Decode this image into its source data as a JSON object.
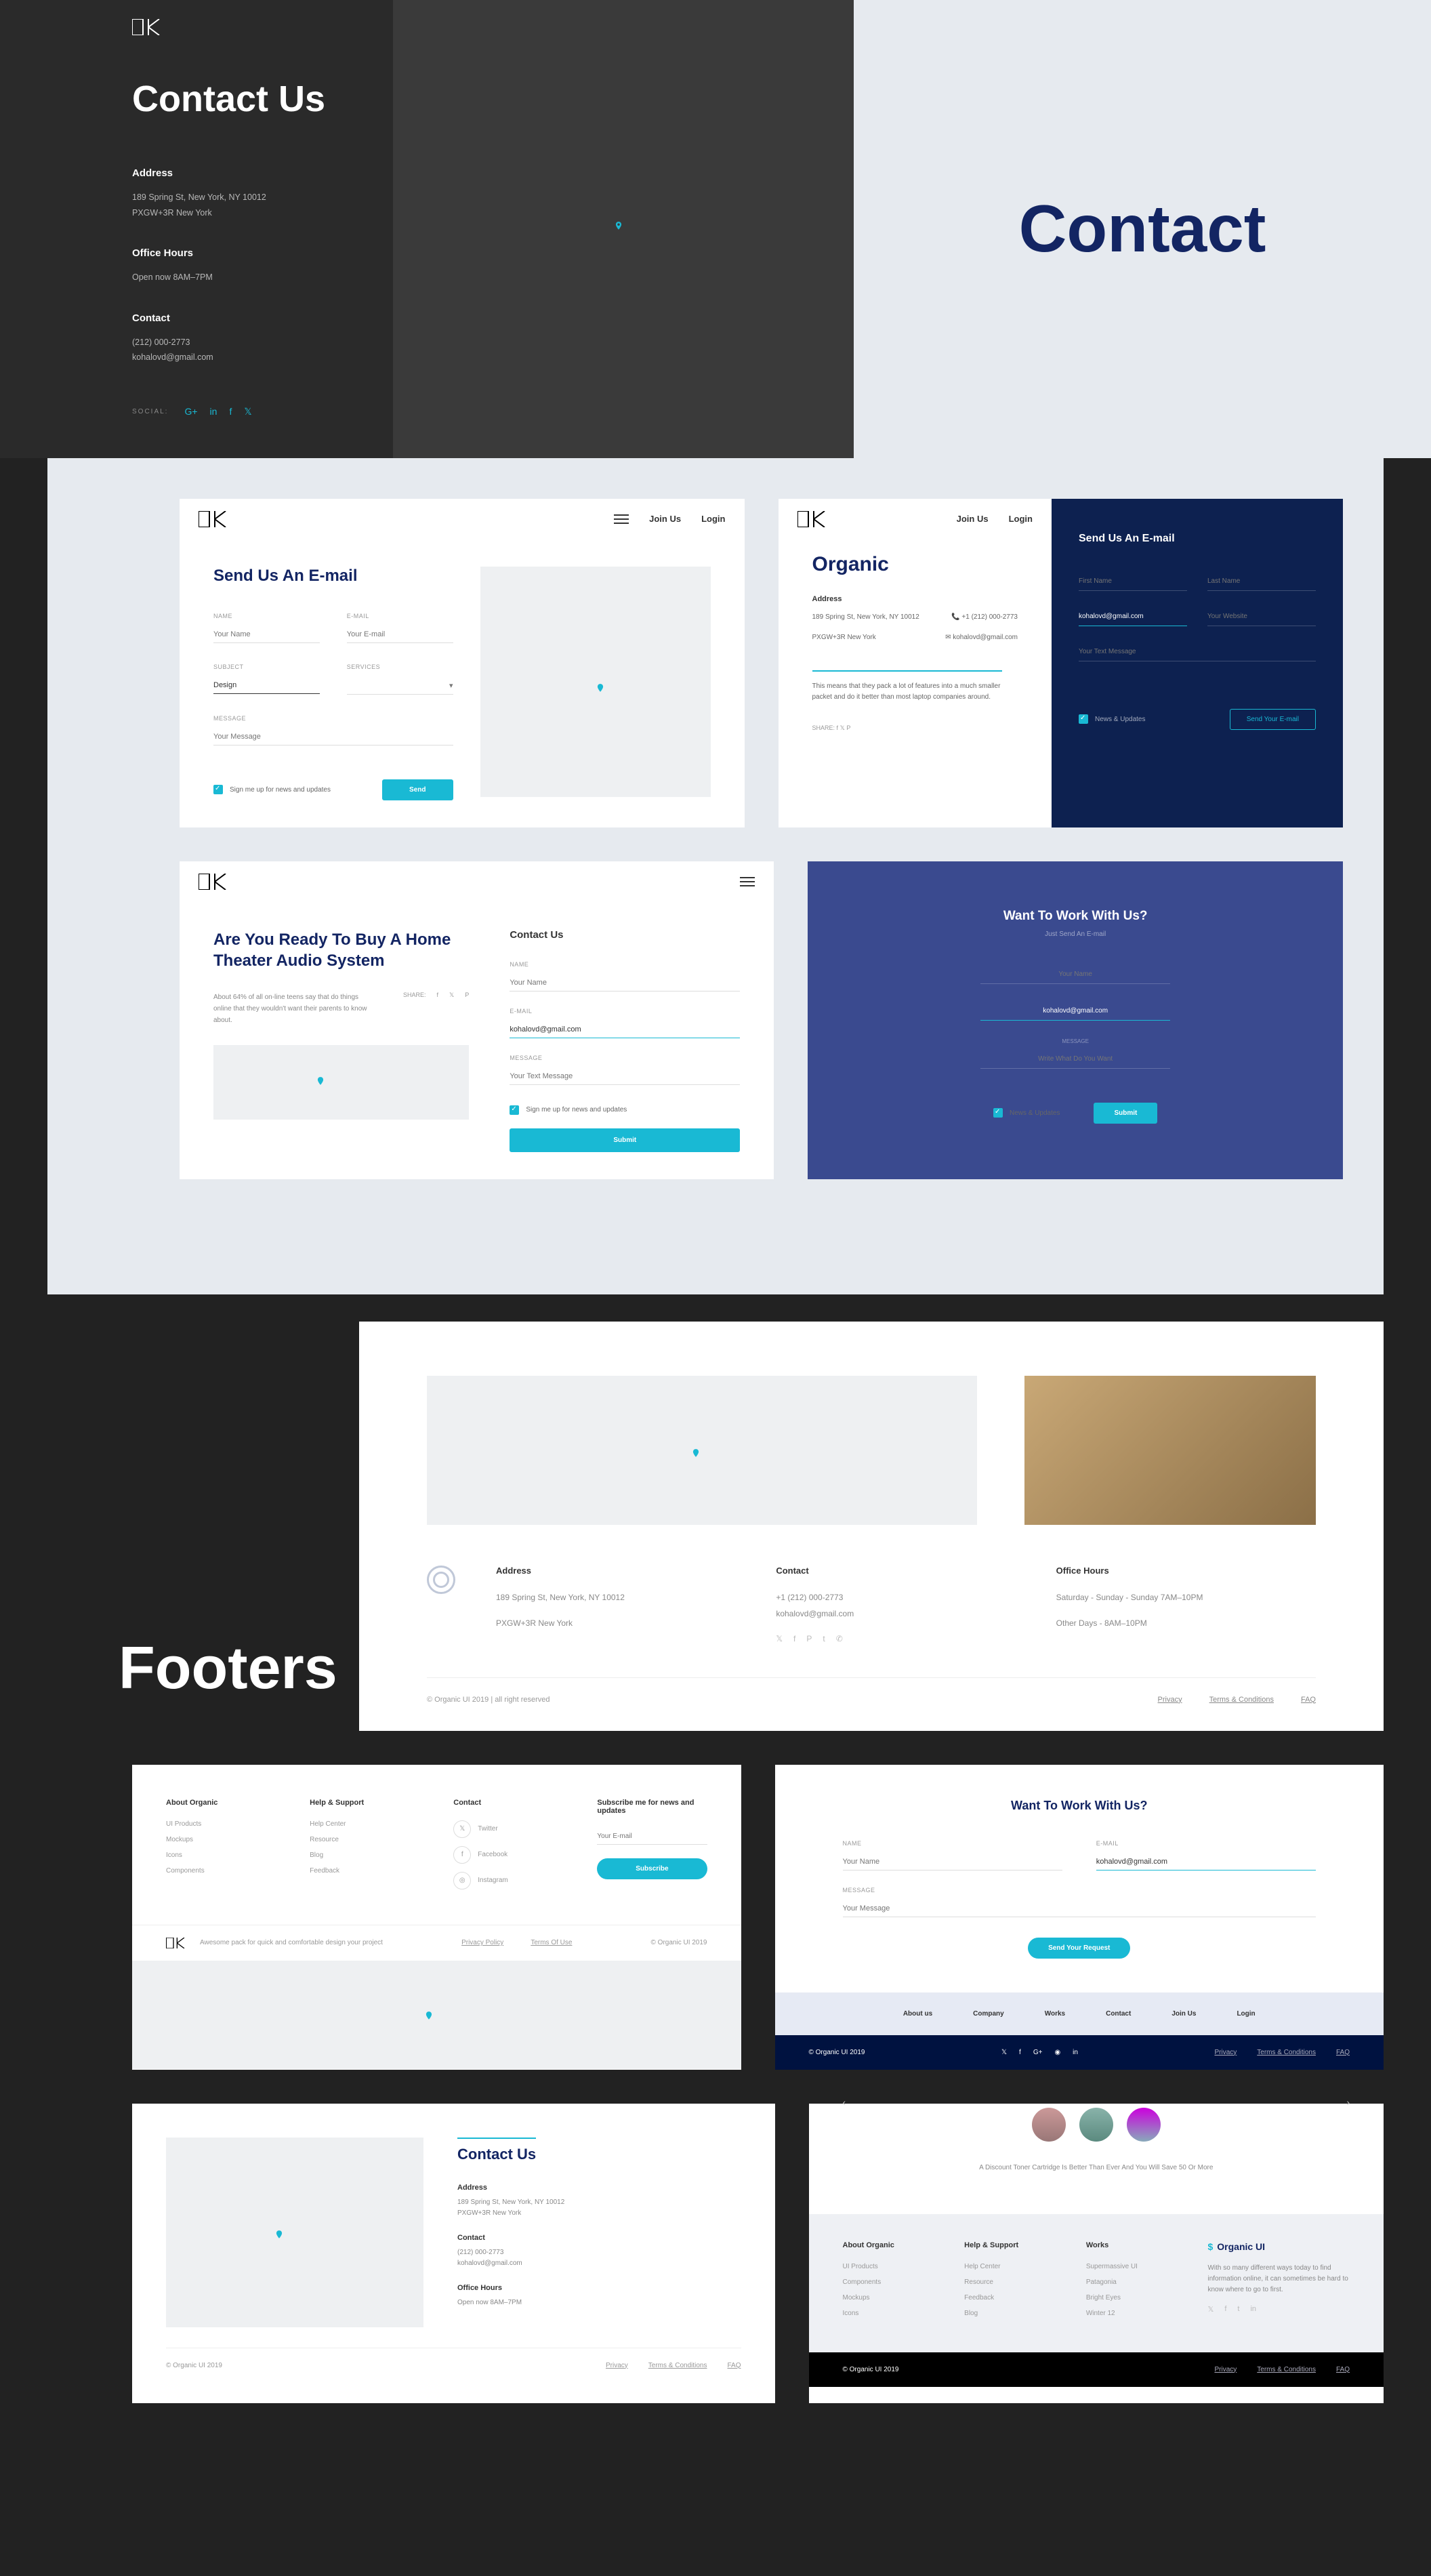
{
  "nav": {
    "join": "Join Us",
    "login": "Login"
  },
  "hero": {
    "title": "Contact Us",
    "address_label": "Address",
    "address_text": "189 Spring St, New York, NY 10012\nPXGW+3R New York",
    "hours_label": "Office Hours",
    "hours_text": "Open now 8AM–7PM",
    "contact_label": "Contact",
    "contact_text": "(212) 000-2773\nkohalovd@gmail.com",
    "social_label": "SOCIAL:",
    "big_title": "Contact"
  },
  "card_a": {
    "title": "Send Us An E-mail",
    "name_label": "NAME",
    "name_ph": "Your Name",
    "email_label": "E-MAIL",
    "email_ph": "Your E-mail",
    "subject_label": "SUBJECT",
    "subject_val": "Design",
    "services_label": "SERVICES",
    "message_label": "MESSAGE",
    "message_ph": "Your Message",
    "signup": "Sign me up for news and updates",
    "send": "Send"
  },
  "card_b": {
    "title": "Organic",
    "address_label": "Address",
    "addr1": "189 Spring St, New York, NY 10012",
    "addr2": "PXGW+3R New York",
    "phone_icon_text": "+1 (212) 000-2773",
    "email_icon_text": "kohalovd@gmail.com",
    "desc": "This means that they pack a lot of features into a much smaller packet and do it better than most laptop companies around.",
    "share": "SHARE:",
    "send_title": "Send Us An E-mail",
    "fn": "First Name",
    "ln": "Last Name",
    "email_val": "kohalovd@gmail.com",
    "web": "Your Website",
    "msg": "Your Text Message",
    "news": "News & Updates",
    "btn": "Send Your E-mail"
  },
  "card_c": {
    "title": "Are You Ready To Buy A Home Theater Audio System",
    "text": "About 64% of all on-line teens say that do things online that they wouldn't want their parents to know about.",
    "share": "SHARE:",
    "contact_title": "Contact Us",
    "name_label": "NAME",
    "name_ph": "Your Name",
    "email_label": "E-MAIL",
    "email_val": "kohalovd@gmail.com",
    "message_label": "MESSAGE",
    "message_ph": "Your Text Message",
    "signup": "Sign me up for news and updates",
    "submit": "Submit"
  },
  "card_d": {
    "title": "Want To Work With Us?",
    "sub": "Just Send An E-mail",
    "name": "Your Name",
    "email": "kohalovd@gmail.com",
    "msg_label": "MESSAGE",
    "msg": "Write What Do You Want",
    "news": "News & Updates",
    "submit": "Submit"
  },
  "footers_title": "Footers",
  "f1": {
    "address_label": "Address",
    "address": "189 Spring St, New York, NY 10012",
    "address2": "PXGW+3R New York",
    "contact_label": "Contact",
    "phone": "+1 (212) 000-2773",
    "email": "kohalovd@gmail.com",
    "hours_label": "Office Hours",
    "hours1": "Saturday - Sunday - Sunday 7AM–10PM",
    "hours2": "Other Days - 8AM–10PM",
    "copyright": "© Organic UI 2019  |  all right reserved",
    "privacy": "Privacy",
    "terms": "Terms & Conditions",
    "faq": "FAQ"
  },
  "f2": {
    "about_h": "About Organic",
    "about_items": [
      "UI Products",
      "Mockups",
      "Icons",
      "Components"
    ],
    "help_h": "Help & Support",
    "help_items": [
      "Help Center",
      "Resource",
      "Blog",
      "Feedback"
    ],
    "contact_h": "Contact",
    "contact_items": [
      "Twitter",
      "Facebook",
      "Instagram"
    ],
    "sub_h": "Subscribe me for news and updates",
    "sub_ph": "Your E-mail",
    "sub_btn": "Subscribe",
    "pack": "Awesome pack for quick and comfortable design your project",
    "privacy": "Privacy Policy",
    "terms": "Terms Of Use",
    "copy": "© Organic UI 2019"
  },
  "f3": {
    "title": "Want To Work With Us?",
    "name_label": "NAME",
    "name_ph": "Your Name",
    "email_label": "E-MAIL",
    "email_val": "kohalovd@gmail.com",
    "msg_label": "MESSAGE",
    "msg_ph": "Your Message",
    "btn": "Send Your Request",
    "nav": [
      "About us",
      "Company",
      "Works",
      "Contact",
      "Join Us",
      "Login"
    ],
    "copy": "© Organic UI 2019",
    "privacy": "Privacy",
    "terms": "Terms & Conditions",
    "faq": "FAQ"
  },
  "f4": {
    "title": "Contact Us",
    "address_label": "Address",
    "address": "189 Spring St, New York, NY 10012\nPXGW+3R New York",
    "contact_label": "Contact",
    "contact": "(212) 000-2773\nkohalovd@gmail.com",
    "hours_label": "Office Hours",
    "hours": "Open now 8AM–7PM",
    "copy": "© Organic UI 2019",
    "privacy": "Privacy",
    "terms": "Terms & Conditions",
    "faq": "FAQ"
  },
  "f5": {
    "quote": "A Discount Toner Cartridge Is Better Than Ever And You Will Save 50 Or More",
    "about_h": "About Organic",
    "about_items": [
      "UI Products",
      "Components",
      "Mockups",
      "Icons"
    ],
    "help_h": "Help & Support",
    "help_items": [
      "Help Center",
      "Resource",
      "Feedback",
      "Blog"
    ],
    "works_h": "Works",
    "works_items": [
      "Supermassive UI",
      "Patagonia",
      "Bright Eyes",
      "Winter 12"
    ],
    "brand": "Organic UI",
    "brand_text": "With so many different ways today to find information online, it can sometimes be hard to know where to go to first.",
    "copy": "© Organic UI 2019",
    "privacy": "Privacy",
    "terms": "Terms & Conditions",
    "faq": "FAQ"
  }
}
